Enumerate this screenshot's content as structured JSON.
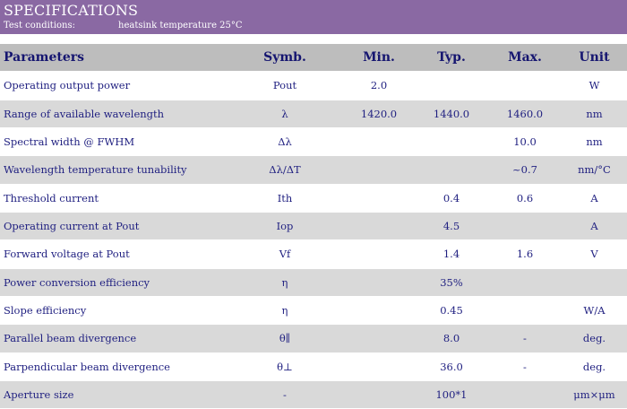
{
  "header": {
    "title": "SPECIFICATIONS",
    "test_label": "Test conditions:",
    "test_value": "heatsink temperature 25°C"
  },
  "table": {
    "columns": [
      "Parameters",
      "Symb.",
      "Min.",
      "Typ.",
      "Max.",
      "Unit"
    ],
    "rows": [
      [
        "Operating output power",
        "Pout",
        "2.0",
        "",
        "",
        "W"
      ],
      [
        "Range of available wavelength",
        "λ",
        "1420.0",
        "1440.0",
        "1460.0",
        "nm"
      ],
      [
        "Spectral width @ FWHM",
        "Δλ",
        "",
        "",
        "10.0",
        "nm"
      ],
      [
        "Wavelength temperature tunability",
        "Δλ/ΔT",
        "",
        "",
        "~0.7",
        "nm/°C"
      ],
      [
        "Threshold current",
        "Ith",
        "",
        "0.4",
        "0.6",
        "A"
      ],
      [
        "Operating current at Pout",
        "Iop",
        "",
        "4.5",
        "",
        "A"
      ],
      [
        "Forward voltage at Pout",
        "Vf",
        "",
        "1.4",
        "1.6",
        "V"
      ],
      [
        "Power conversion efficiency",
        "η",
        "",
        "35%",
        "",
        ""
      ],
      [
        "Slope efficiency",
        "η",
        "",
        "0.45",
        "",
        "W/A"
      ],
      [
        "Parallel beam divergence",
        "θ∥",
        "",
        "8.0",
        "-",
        "deg."
      ],
      [
        "Parpendicular beam divergence",
        "θ⊥",
        "",
        "36.0",
        "-",
        "deg."
      ],
      [
        "Aperture size",
        "-",
        "",
        "100*1",
        "",
        "μm×μm"
      ]
    ]
  }
}
